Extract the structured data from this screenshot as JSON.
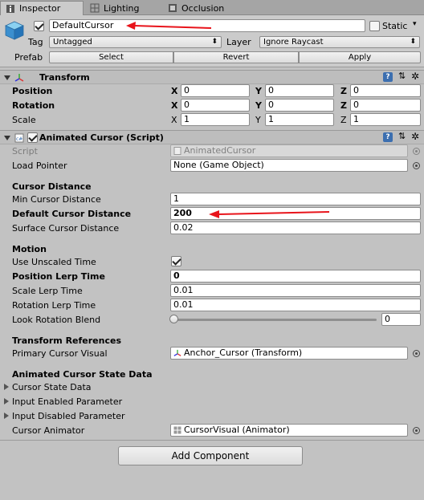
{
  "tabs": [
    {
      "label": "Inspector",
      "icon": "info-icon"
    },
    {
      "label": "Lighting",
      "icon": "lighting-icon"
    },
    {
      "label": "Occlusion",
      "icon": "occlusion-icon"
    }
  ],
  "header": {
    "object_name": "DefaultCursor",
    "active": true,
    "static_label": "Static",
    "static_checked": false,
    "tag_label": "Tag",
    "tag_value": "Untagged",
    "layer_label": "Layer",
    "layer_value": "Ignore Raycast",
    "prefab_label": "Prefab",
    "prefab_buttons": [
      "Select",
      "Revert",
      "Apply"
    ]
  },
  "transform": {
    "title": "Transform",
    "rows": [
      {
        "label": "Position",
        "bold": true,
        "x": "0",
        "y": "0",
        "z": "0"
      },
      {
        "label": "Rotation",
        "bold": true,
        "x": "0",
        "y": "0",
        "z": "0"
      },
      {
        "label": "Scale",
        "bold": false,
        "x": "1",
        "y": "1",
        "z": "1"
      }
    ],
    "axis_labels": [
      "X",
      "Y",
      "Z"
    ]
  },
  "script_component": {
    "title": "Animated Cursor (Script)",
    "enabled": true,
    "script_label": "Script",
    "script_value": "AnimatedCursor",
    "load_pointer_label": "Load Pointer",
    "load_pointer_value": "None (Game Object)",
    "cursor_distance_header": "Cursor Distance",
    "min_cursor_distance_label": "Min Cursor Distance",
    "min_cursor_distance_value": "1",
    "default_cursor_distance_label": "Default Cursor Distance",
    "default_cursor_distance_value": "200",
    "surface_cursor_distance_label": "Surface Cursor Distance",
    "surface_cursor_distance_value": "0.02",
    "motion_header": "Motion",
    "use_unscaled_time_label": "Use Unscaled Time",
    "use_unscaled_time_checked": true,
    "position_lerp_time_label": "Position Lerp Time",
    "position_lerp_time_value": "0",
    "scale_lerp_time_label": "Scale Lerp Time",
    "scale_lerp_time_value": "0.01",
    "rotation_lerp_time_label": "Rotation Lerp Time",
    "rotation_lerp_time_value": "0.01",
    "look_rotation_blend_label": "Look Rotation Blend",
    "look_rotation_blend_value": "0",
    "look_rotation_blend_fraction": 0,
    "transform_references_header": "Transform References",
    "primary_cursor_visual_label": "Primary Cursor Visual",
    "primary_cursor_visual_value": "Anchor_Cursor (Transform)",
    "state_data_header": "Animated Cursor State Data",
    "cursor_state_data_label": "Cursor State Data",
    "input_enabled_parameter_label": "Input Enabled Parameter",
    "input_disabled_parameter_label": "Input Disabled Parameter",
    "cursor_animator_label": "Cursor Animator",
    "cursor_animator_value": "CursorVisual (Animator)"
  },
  "add_component_label": "Add Component",
  "colors": {
    "annotation_arrow": "#e8141b",
    "panel_bg": "#c2c2c2"
  }
}
